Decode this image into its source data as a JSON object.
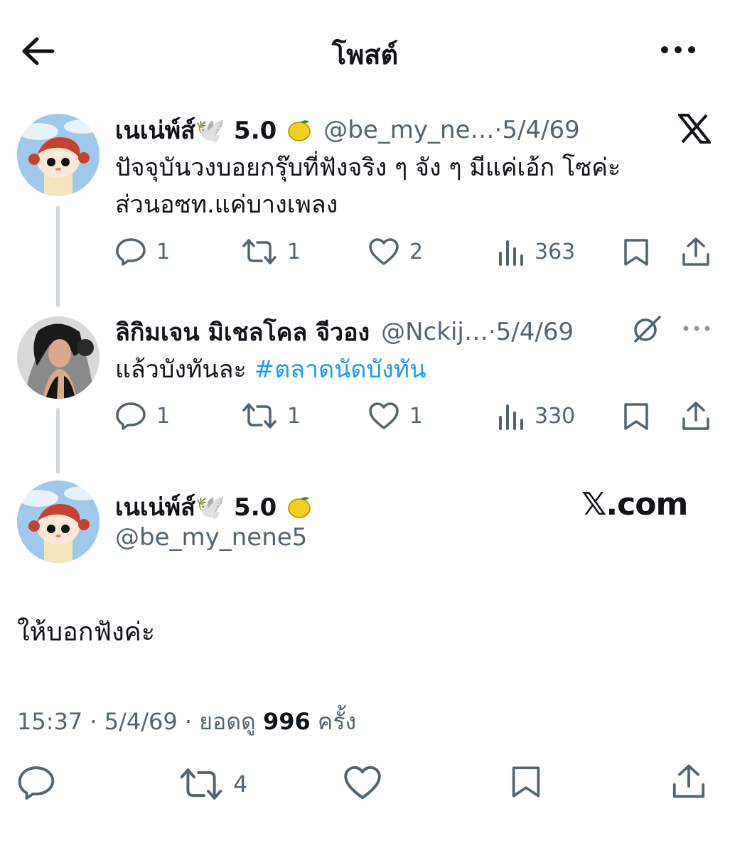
{
  "header": {
    "title": "โพสต์"
  },
  "tweets": [
    {
      "name": "เนเน่พ์ส์🕊️ 5.0",
      "handle": "@be_my_ne…",
      "date": "·5/4/69",
      "text_line1": "ปัจจุบันวงบอยกรุ๊บที่ฟังจริง ๆ จัง ๆ มีแค่เอ้ก โซค่ะ",
      "text_line2": "ส่วนอซท.แค่บางเพลง",
      "replies": "1",
      "retweets": "1",
      "likes": "2",
      "views": "363"
    },
    {
      "name": "ลิกิมเจน มิเชลโคล จีวอง",
      "handle": "@Nckij…",
      "date": "·5/4/69",
      "text": "แล้วบังทันละ ",
      "hashtag": "#ตลาดนัดบังทัน",
      "replies": "1",
      "retweets": "1",
      "likes": "1",
      "views": "330"
    }
  ],
  "main": {
    "name": "เนเน่พ์ส์🕊️ 5.0",
    "handle": "@be_my_nene5",
    "watermark": "𝕏.com",
    "text": "ให้บอกฟังค่ะ",
    "time": "15:37 · 5/4/69 · ยอดดู ",
    "views": "996",
    "views_suffix": " ครั้ง",
    "retweets": "4"
  },
  "colors": {
    "accent": "#1d9bf0",
    "text": "#0f1419",
    "secondary": "#536471",
    "line": "#cfd9de"
  }
}
